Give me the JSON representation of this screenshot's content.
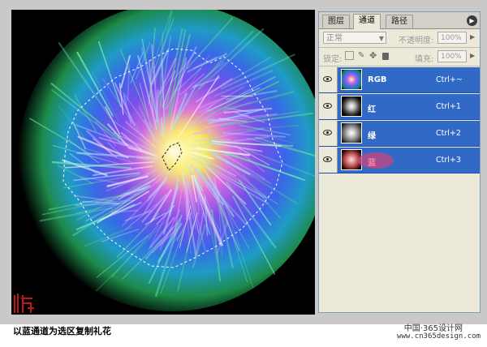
{
  "caption": "以蓝通道为选区复制礼花",
  "watermark": {
    "site_cn": "中国·365设计网",
    "url": "www.cn365design.com"
  },
  "channels_panel": {
    "tabs": [
      {
        "label": "图层",
        "active": false
      },
      {
        "label": "通道",
        "active": true
      },
      {
        "label": "路径",
        "active": false
      }
    ],
    "blend_mode": "正常",
    "opacity_label": "不透明度:",
    "opacity_value": "100%",
    "lock_label": "锁定:",
    "fill_label": "填充:",
    "fill_value": "100%",
    "channels": [
      {
        "name": "RGB",
        "shortcut": "Ctrl+~",
        "visible": true
      },
      {
        "name": "红",
        "shortcut": "Ctrl+1",
        "visible": true
      },
      {
        "name": "绿",
        "shortcut": "Ctrl+2",
        "visible": true
      },
      {
        "name": "蓝",
        "shortcut": "Ctrl+3",
        "visible": true
      }
    ],
    "menu_icon": "panel-menu-arrow-icon"
  },
  "colors": {
    "selected_row": "#3169c6",
    "panel_bg": "#ece9d8",
    "frame_bg": "#c9c9c9"
  }
}
